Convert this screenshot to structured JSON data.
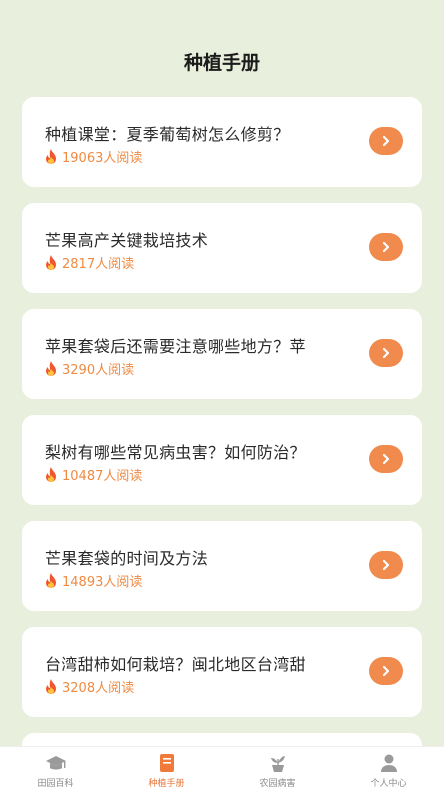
{
  "header": {
    "title": "种植手册"
  },
  "articles": [
    {
      "title": "种植课堂：夏季葡萄树怎么修剪？",
      "reads": "19063人阅读"
    },
    {
      "title": "芒果高产关键栽培技术",
      "reads": "2817人阅读"
    },
    {
      "title": "苹果套袋后还需要注意哪些地方？苹",
      "reads": "3290人阅读"
    },
    {
      "title": "梨树有哪些常见病虫害？如何防治？",
      "reads": "10487人阅读"
    },
    {
      "title": "芒果套袋的时间及方法",
      "reads": "14893人阅读"
    },
    {
      "title": "台湾甜柿如何栽培？闽北地区台湾甜",
      "reads": "3208人阅读"
    }
  ],
  "tabbar": {
    "items": [
      {
        "label": "田园百科",
        "icon": "graduation-cap-icon",
        "active": false
      },
      {
        "label": "种植手册",
        "icon": "book-icon",
        "active": true
      },
      {
        "label": "农园病害",
        "icon": "plant-pot-icon",
        "active": false
      },
      {
        "label": "个人中心",
        "icon": "person-icon",
        "active": false
      }
    ]
  },
  "colors": {
    "accent": "#f08a4d",
    "background": "#e8efdc",
    "read_count": "#ef8a43"
  }
}
